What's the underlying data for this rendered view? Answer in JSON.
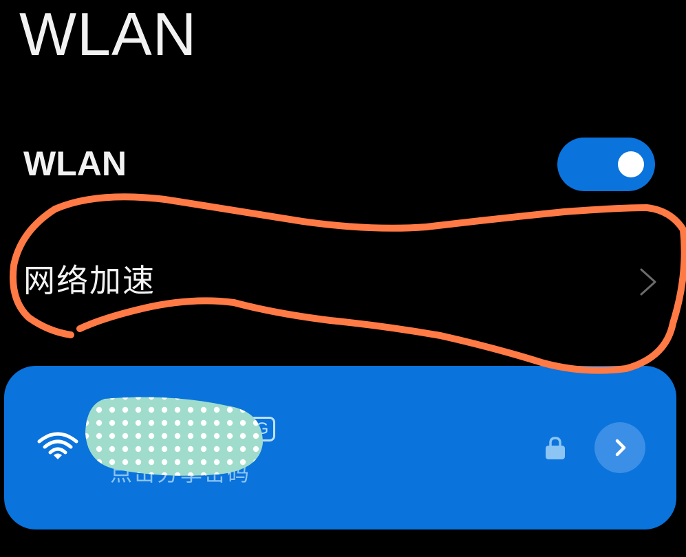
{
  "header": {
    "title": "WLAN"
  },
  "wlan_toggle": {
    "label": "WLAN",
    "state": "on",
    "color": "#0a73dc"
  },
  "network_acceleration": {
    "label": "网络加速",
    "chevron_icon": "chevron-right-icon"
  },
  "annotation": {
    "color": "#ff7a45",
    "shape": "hand-drawn loop around 网络加速"
  },
  "connected_network": {
    "ssid": "",
    "band_badge": "G",
    "hint": "点击分享密码",
    "wifi_icon": "wifi-icon",
    "lock_icon": "lock-icon",
    "detail_icon": "chevron-right-icon",
    "card_color": "#0a73dc",
    "redaction_color": "#9fdccb"
  }
}
